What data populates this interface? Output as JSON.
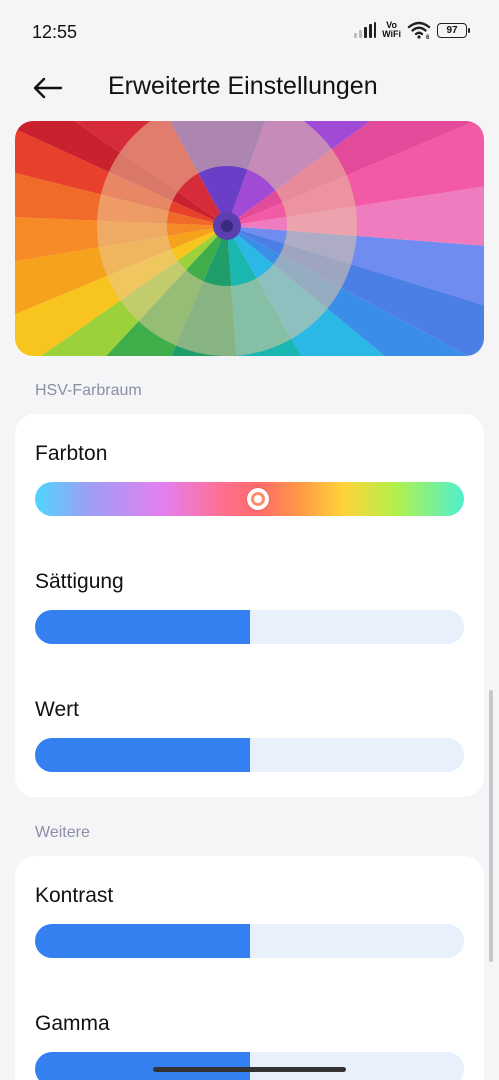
{
  "status_bar": {
    "time": "12:55",
    "vo_label": "Vo",
    "wifi_label": "WiFi",
    "wifi_sub": "6",
    "battery": "97",
    "icons": [
      "signal-icon",
      "wifi-icon",
      "battery-icon"
    ]
  },
  "header": {
    "back_icon": "arrow-left-icon",
    "title": "Erweiterte Einstellungen"
  },
  "banner": {
    "description_icon": "colored-pencils-image"
  },
  "sections": {
    "hsv": {
      "label": "HSV-Farbraum",
      "hue": {
        "label": "Farbton",
        "value": 0.52
      },
      "saturation": {
        "label": "Sättigung",
        "value": 0.5
      },
      "value": {
        "label": "Wert",
        "value": 0.5
      }
    },
    "more": {
      "label": "Weitere",
      "contrast": {
        "label": "Kontrast",
        "value": 0.5
      },
      "gamma": {
        "label": "Gamma",
        "value": 0.5
      }
    }
  },
  "colors": {
    "accent": "#3580f0",
    "track": "#e8f0fc",
    "background": "#f5f5f7",
    "section_label": "#8a8fa6"
  }
}
